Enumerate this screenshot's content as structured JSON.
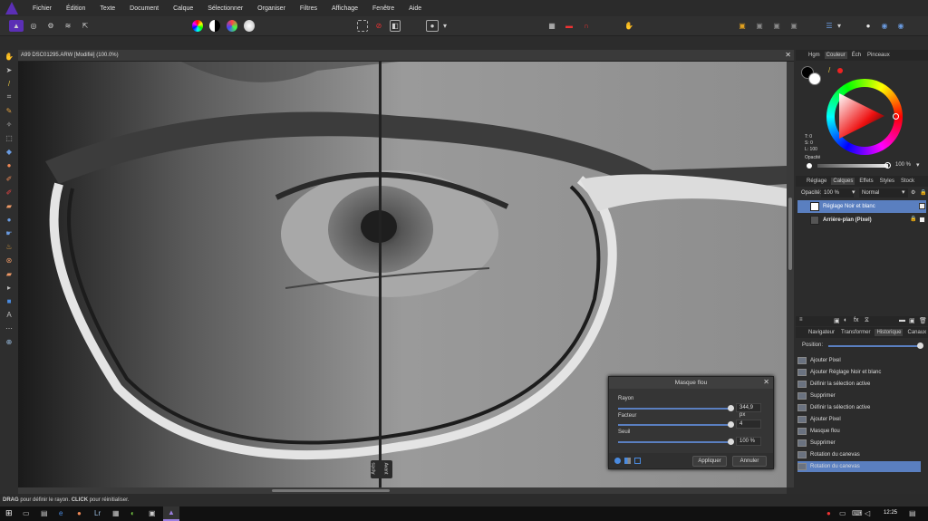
{
  "menubar": {
    "items": [
      "Fichier",
      "Édition",
      "Texte",
      "Document",
      "Calque",
      "Sélectionner",
      "Organiser",
      "Filtres",
      "Affichage",
      "Fenêtre",
      "Aide"
    ]
  },
  "document": {
    "tab_title": "A99 DSC01295.ARW [Modifié] (100.0%)",
    "split_label_after": "Après",
    "split_label_before": "Avant"
  },
  "color_panel": {
    "tabs": [
      "Hgm",
      "Couleur",
      "Éch",
      "Pinceaux"
    ],
    "active_tab": "Couleur",
    "t_label": "T: 0",
    "s_label": "S: 0",
    "l_label": "L: 100",
    "opacity_label": "Opacité",
    "opacity_value": "100 %"
  },
  "layers_panel": {
    "tabs": [
      "Réglage",
      "Calques",
      "Effets",
      "Styles",
      "Stock"
    ],
    "active_tab": "Calques",
    "opacity_label": "Opacité:",
    "opacity_value": "100 %",
    "blend_mode": "Normal",
    "layers": [
      {
        "name": "Réglage Noir et blanc",
        "selected": true
      },
      {
        "name": "Arrière-plan (Pixel)",
        "selected": false
      }
    ]
  },
  "history_panel": {
    "tabs": [
      "Navigateur",
      "Transformer",
      "Historique",
      "Canaux"
    ],
    "active_tab": "Historique",
    "position_label": "Position:",
    "items": [
      "Ajouter Pixel",
      "Ajouter Réglage Noir et blanc",
      "Définir la sélection active",
      "Supprimer",
      "Définir la sélection active",
      "Ajouter Pixel",
      "Masque flou",
      "Supprimer",
      "Rotation du canevas",
      "Rotation du canevas"
    ],
    "selected_index": 9
  },
  "dialog": {
    "title": "Masque flou",
    "rayon_label": "Rayon",
    "rayon_value": "344,9 px",
    "facteur_label": "Facteur",
    "facteur_value": "4",
    "seuil_label": "Seuil",
    "seuil_value": "100 %",
    "apply_label": "Appliquer",
    "cancel_label": "Annuler"
  },
  "status": {
    "drag_word": "DRAG",
    "drag_text": " pour définir le rayon. ",
    "click_word": "CLICK",
    "click_text": " pour réinitialiser."
  },
  "taskbar": {
    "clock": "12:25"
  },
  "colors": {
    "accent": "#5a7fc0",
    "app_logo": "#5b2fb5"
  }
}
